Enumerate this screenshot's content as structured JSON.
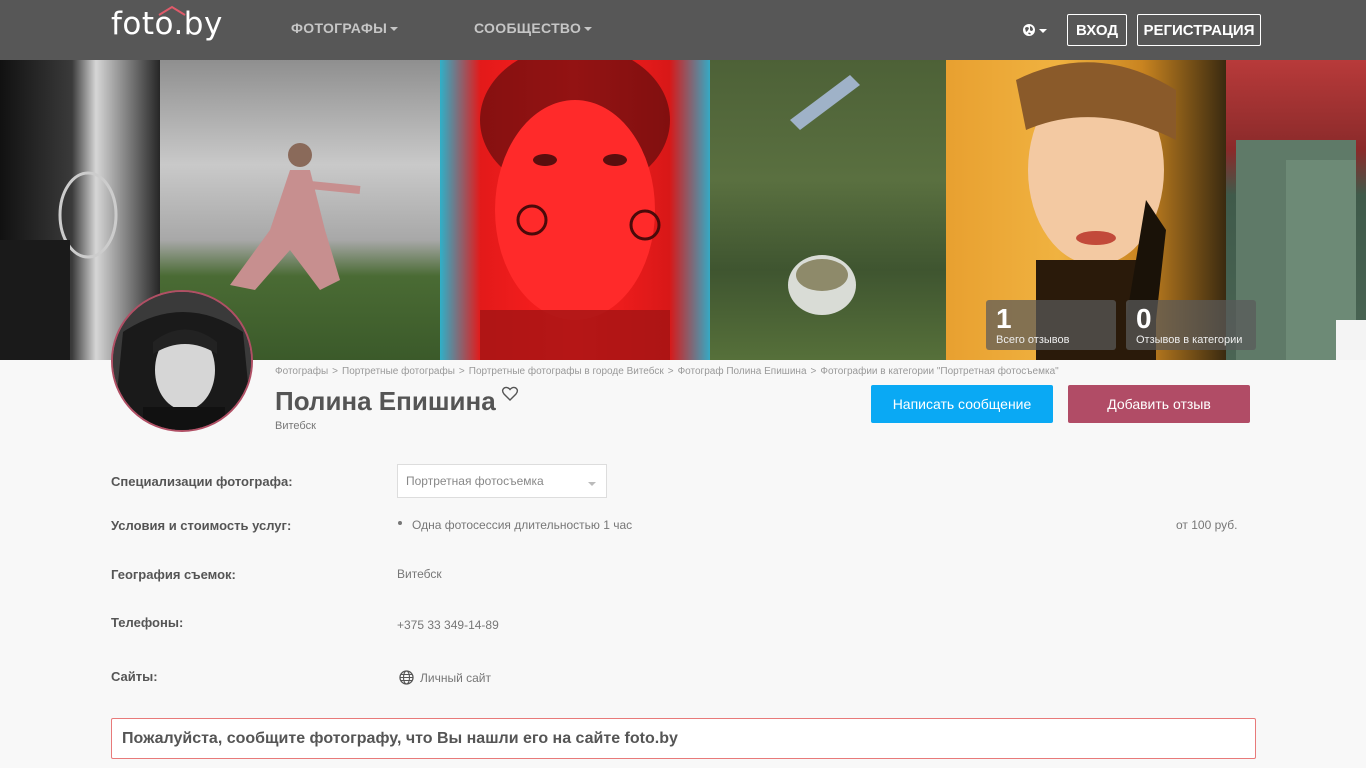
{
  "header": {
    "logo_text": "foto.by",
    "nav": [
      {
        "label": "ФОТОГРАФЫ"
      },
      {
        "label": "СООБЩЕСТВО"
      }
    ],
    "login_label": "ВХОД",
    "register_label": "РЕГИСТРАЦИЯ"
  },
  "banner": {
    "stats": [
      {
        "value": "1",
        "label": "Всего отзывов"
      },
      {
        "value": "0",
        "label": "Отзывов в категории"
      }
    ]
  },
  "breadcrumbs": [
    "Фотографы",
    "Портретные фотографы",
    "Портретные фотографы в городе Витебск",
    "Фотограф Полина Епишина",
    "Фотографии в категории \"Портретная фотосъемка\""
  ],
  "breadcrumb_separator": ">",
  "profile": {
    "name": "Полина Епишина",
    "city": "Витебск",
    "message_button": "Написать сообщение",
    "review_button": "Добавить отзыв"
  },
  "info": {
    "specializations_label": "Специализации фотографа:",
    "specialization_selected": "Портретная фотосъемка",
    "services_label": "Условия и стоимость услуг:",
    "service_item": "Одна фотосессия длительностью 1 час",
    "service_price": "от 100 руб.",
    "geography_label": "География съемок:",
    "geography_value": "Витебск",
    "phones_label": "Телефоны:",
    "phone_value": "+375 33 349-14-89",
    "sites_label": "Сайты:",
    "site_value": "Личный сайт"
  },
  "notice": "Пожалуйста, сообщите фотографу, что Вы нашли его на сайте foto.by",
  "colors": {
    "topbar": "#575757",
    "message_button": "#0aa9f4",
    "review_button": "#b14c66",
    "notice_border": "#e87a7a"
  }
}
